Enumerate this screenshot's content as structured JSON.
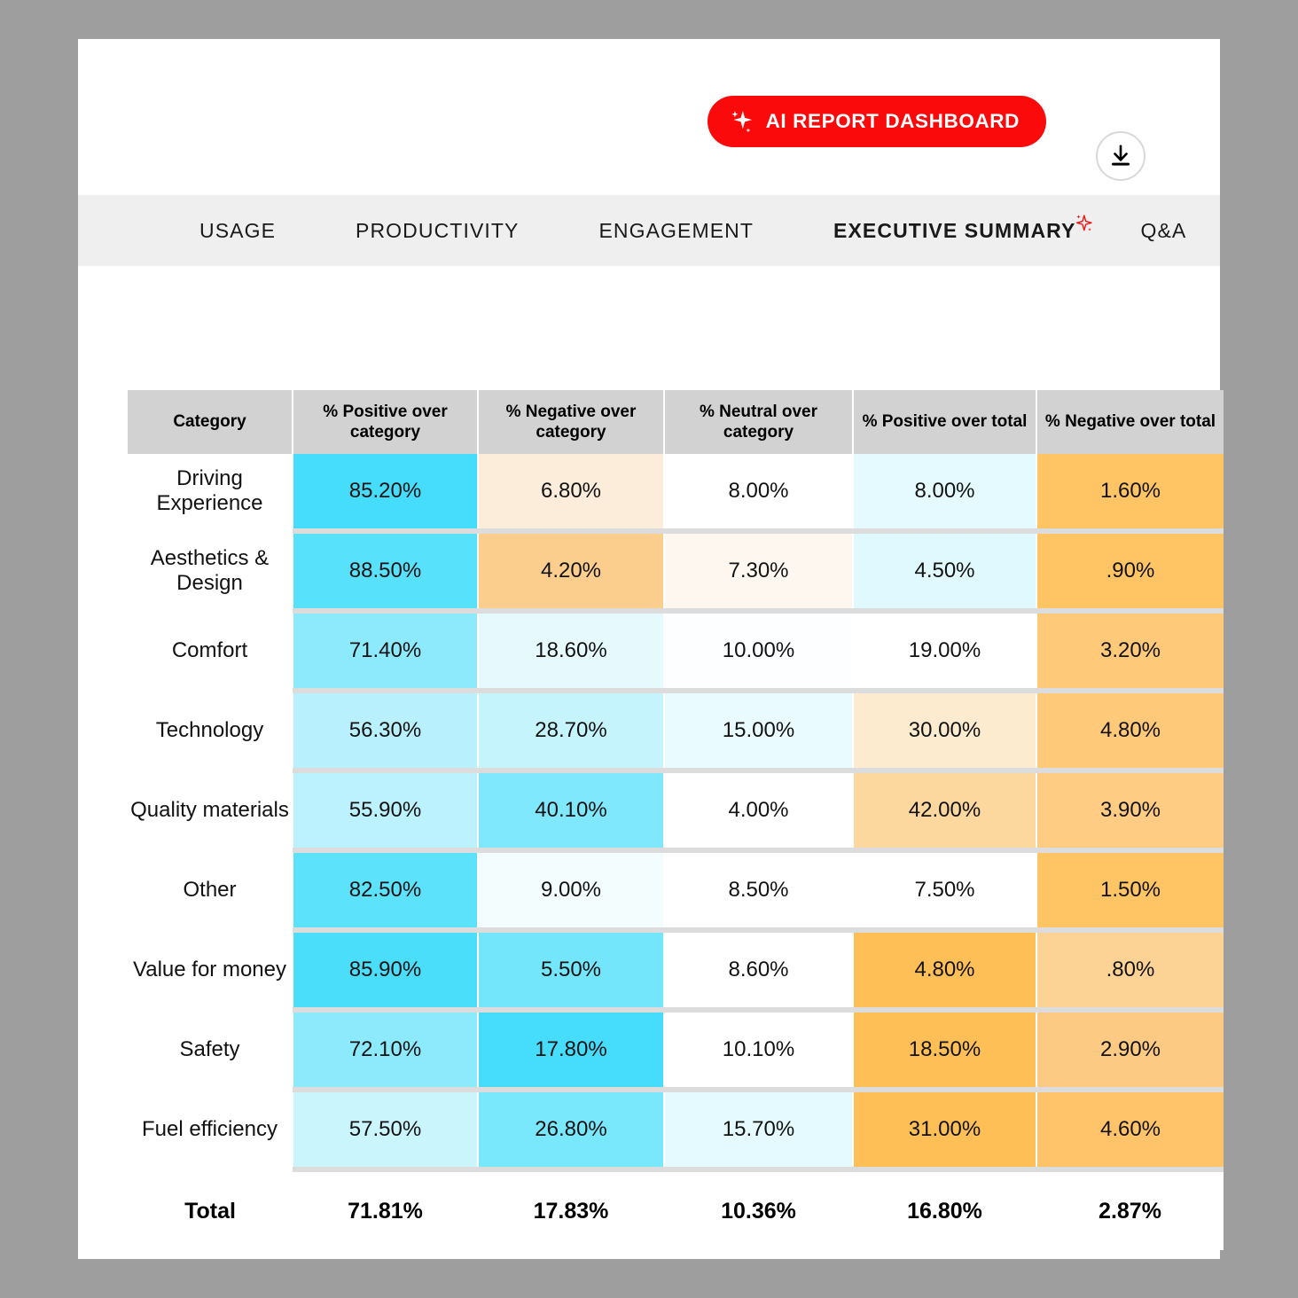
{
  "header": {
    "ai_button_label": "AI REPORT DASHBOARD",
    "ai_button_icon": "sparkle-icon",
    "ai_button_color": "#FA0A0A",
    "download_icon": "download-icon"
  },
  "nav": {
    "items": [
      {
        "label": "USAGE",
        "active": false
      },
      {
        "label": "PRODUCTIVITY",
        "active": false
      },
      {
        "label": "ENGAGEMENT",
        "active": false
      },
      {
        "label": "EXECUTIVE SUMMARY",
        "active": true,
        "icon": "sparkle-icon"
      },
      {
        "label": "Q&A",
        "active": false
      }
    ]
  },
  "chart_data": {
    "type": "table",
    "title": "",
    "columns": [
      "Category",
      "% Positive over category",
      "% Negative over category",
      "% Neutral over category",
      "% Positive over total",
      "% Negative over total"
    ],
    "rows": [
      {
        "category": "Driving Experience",
        "values": [
          "85.20%",
          "6.80%",
          "8.00%",
          "8.00%",
          "1.60%"
        ],
        "colors": [
          "#45DDFB",
          "#FBEDDA",
          "#FFFFFF",
          "#E4FAFE",
          "#FFC463"
        ]
      },
      {
        "category": "Aesthetics & Design",
        "values": [
          "88.50%",
          "4.20%",
          "7.30%",
          "4.50%",
          ".90%"
        ],
        "colors": [
          "#57E1FB",
          "#FCCE8E",
          "#FDF7F0",
          "#E0F9FE",
          "#FFC463"
        ]
      },
      {
        "category": "Comfort",
        "values": [
          "71.40%",
          "18.60%",
          "10.00%",
          "19.00%",
          "3.20%"
        ],
        "colors": [
          "#8CEAFC",
          "#E6FAFE",
          "#FCFEFF",
          "#FFFFFF",
          "#FFC97A"
        ]
      },
      {
        "category": "Technology",
        "values": [
          "56.30%",
          "28.70%",
          "15.00%",
          "30.00%",
          "4.80%"
        ],
        "colors": [
          "#B8F1FD",
          "#C6F4FD",
          "#E9FBFE",
          "#FCEBCE",
          "#FFC97A"
        ]
      },
      {
        "category": "Quality materials",
        "values": [
          "55.90%",
          "40.10%",
          "4.00%",
          "42.00%",
          "3.90%"
        ],
        "colors": [
          "#BBF2FD",
          "#7FE8FC",
          "#FFFFFF",
          "#FCD79E",
          "#FFCC84"
        ]
      },
      {
        "category": "Other",
        "values": [
          "82.50%",
          "9.00%",
          "8.50%",
          "7.50%",
          "1.50%"
        ],
        "colors": [
          "#5CE2FB",
          "#F3FDFE",
          "#FFFFFF",
          "#FFFFFF",
          "#FFC463"
        ]
      },
      {
        "category": "Value for money",
        "values": [
          "85.90%",
          "5.50%",
          "8.60%",
          "4.80%",
          ".80%"
        ],
        "colors": [
          "#4ADEFB",
          "#74E6FC",
          "#FFFFFF",
          "#FFBF57",
          "#FDD295"
        ]
      },
      {
        "category": "Safety",
        "values": [
          "72.10%",
          "17.80%",
          "10.10%",
          "18.50%",
          "2.90%"
        ],
        "colors": [
          "#8CEAFC",
          "#45DDFB",
          "#FFFFFF",
          "#FFBF57",
          "#FDCA84"
        ]
      },
      {
        "category": "Fuel efficiency",
        "values": [
          "57.50%",
          "26.80%",
          "15.70%",
          "31.00%",
          "4.60%"
        ],
        "colors": [
          "#CBF5FD",
          "#79E7FC",
          "#E4FAFE",
          "#FFBF57",
          "#FFC469"
        ]
      }
    ],
    "total_row": {
      "label": "Total",
      "values": [
        "71.81%",
        "17.83%",
        "10.36%",
        "16.80%",
        "2.87%"
      ]
    },
    "colorscale_positive": "#45DDFB",
    "colorscale_negative": "#FFBF57",
    "header_bg": "#D2D2D2"
  }
}
